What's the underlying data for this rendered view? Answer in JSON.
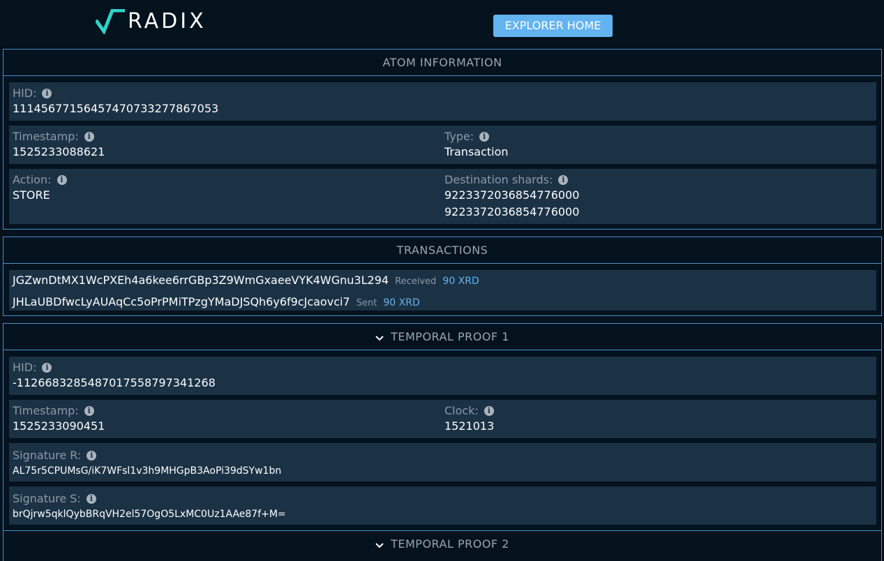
{
  "header": {
    "logo_text": "RADIX",
    "explorer_home_label": "EXPLORER HOME"
  },
  "atom": {
    "title": "ATOM INFORMATION",
    "hid_label": "HID:",
    "hid_value": "11145677156457470733277867053",
    "timestamp_label": "Timestamp:",
    "timestamp_value": "1525233088621",
    "type_label": "Type:",
    "type_value": "Transaction",
    "action_label": "Action:",
    "action_value": "STORE",
    "shards_label": "Destination shards:",
    "shards": [
      "9223372036854776000",
      "9223372036854776000"
    ]
  },
  "transactions": {
    "title": "TRANSACTIONS",
    "items": [
      {
        "address": "JGZwnDtMX1WcPXEh4a6kee6rrGBp3Z9WmGxaeeVYK4WGnu3L294",
        "direction": "Received",
        "amount": "90 XRD"
      },
      {
        "address": "JHLaUBDfwcLyAUAqCc5oPrPMiTPzgYMaDJSQh6y6f9cJcaovci7",
        "direction": "Sent",
        "amount": "90 XRD"
      }
    ]
  },
  "proof1": {
    "title": "TEMPORAL PROOF 1",
    "hid_label": "HID:",
    "hid_value": "-1126683285487017558797341268",
    "timestamp_label": "Timestamp:",
    "timestamp_value": "1525233090451",
    "clock_label": "Clock:",
    "clock_value": "1521013",
    "sig_r_label": "Signature R:",
    "sig_r_value": "AL75r5CPUMsG/iK7WFsl1v3h9MHGpB3AoPi39dSYw1bn",
    "sig_s_label": "Signature S:",
    "sig_s_value": "brQjrw5qklQybBRqVH2el57OgO5LxMC0Uz1AAe87f+M="
  },
  "proof2": {
    "title": "TEMPORAL PROOF 2"
  },
  "colors": {
    "background": "#04121e",
    "row": "#1b3245",
    "border": "#4a8fc9",
    "accent": "#63b3f0",
    "logo_check": "#2fd3c6"
  },
  "icons": [
    "radix-check-icon",
    "info-icon",
    "chevron-down-icon"
  ]
}
